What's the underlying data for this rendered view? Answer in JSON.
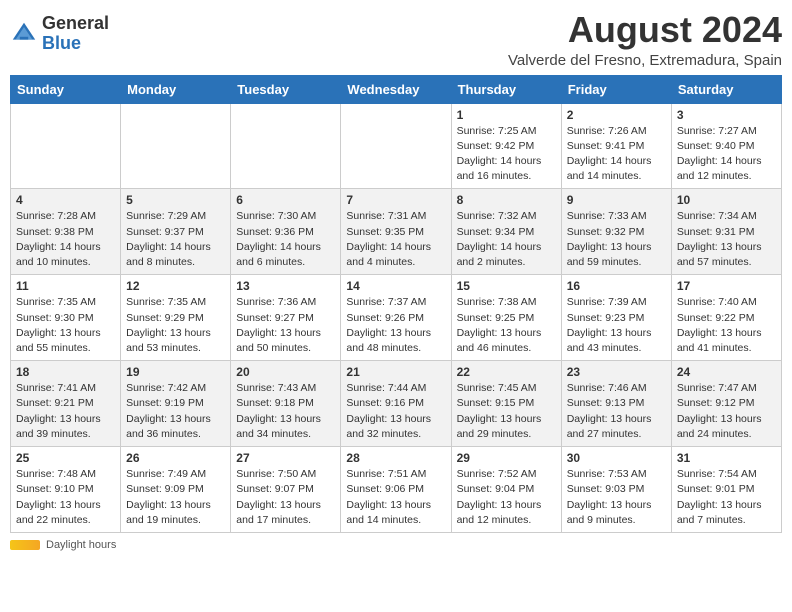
{
  "header": {
    "logo_general": "General",
    "logo_blue": "Blue",
    "month_year": "August 2024",
    "location": "Valverde del Fresno, Extremadura, Spain"
  },
  "days_of_week": [
    "Sunday",
    "Monday",
    "Tuesday",
    "Wednesday",
    "Thursday",
    "Friday",
    "Saturday"
  ],
  "weeks": [
    [
      {
        "day": "",
        "info": ""
      },
      {
        "day": "",
        "info": ""
      },
      {
        "day": "",
        "info": ""
      },
      {
        "day": "",
        "info": ""
      },
      {
        "day": "1",
        "info": "Sunrise: 7:25 AM\nSunset: 9:42 PM\nDaylight: 14 hours\nand 16 minutes."
      },
      {
        "day": "2",
        "info": "Sunrise: 7:26 AM\nSunset: 9:41 PM\nDaylight: 14 hours\nand 14 minutes."
      },
      {
        "day": "3",
        "info": "Sunrise: 7:27 AM\nSunset: 9:40 PM\nDaylight: 14 hours\nand 12 minutes."
      }
    ],
    [
      {
        "day": "4",
        "info": "Sunrise: 7:28 AM\nSunset: 9:38 PM\nDaylight: 14 hours\nand 10 minutes."
      },
      {
        "day": "5",
        "info": "Sunrise: 7:29 AM\nSunset: 9:37 PM\nDaylight: 14 hours\nand 8 minutes."
      },
      {
        "day": "6",
        "info": "Sunrise: 7:30 AM\nSunset: 9:36 PM\nDaylight: 14 hours\nand 6 minutes."
      },
      {
        "day": "7",
        "info": "Sunrise: 7:31 AM\nSunset: 9:35 PM\nDaylight: 14 hours\nand 4 minutes."
      },
      {
        "day": "8",
        "info": "Sunrise: 7:32 AM\nSunset: 9:34 PM\nDaylight: 14 hours\nand 2 minutes."
      },
      {
        "day": "9",
        "info": "Sunrise: 7:33 AM\nSunset: 9:32 PM\nDaylight: 13 hours\nand 59 minutes."
      },
      {
        "day": "10",
        "info": "Sunrise: 7:34 AM\nSunset: 9:31 PM\nDaylight: 13 hours\nand 57 minutes."
      }
    ],
    [
      {
        "day": "11",
        "info": "Sunrise: 7:35 AM\nSunset: 9:30 PM\nDaylight: 13 hours\nand 55 minutes."
      },
      {
        "day": "12",
        "info": "Sunrise: 7:35 AM\nSunset: 9:29 PM\nDaylight: 13 hours\nand 53 minutes."
      },
      {
        "day": "13",
        "info": "Sunrise: 7:36 AM\nSunset: 9:27 PM\nDaylight: 13 hours\nand 50 minutes."
      },
      {
        "day": "14",
        "info": "Sunrise: 7:37 AM\nSunset: 9:26 PM\nDaylight: 13 hours\nand 48 minutes."
      },
      {
        "day": "15",
        "info": "Sunrise: 7:38 AM\nSunset: 9:25 PM\nDaylight: 13 hours\nand 46 minutes."
      },
      {
        "day": "16",
        "info": "Sunrise: 7:39 AM\nSunset: 9:23 PM\nDaylight: 13 hours\nand 43 minutes."
      },
      {
        "day": "17",
        "info": "Sunrise: 7:40 AM\nSunset: 9:22 PM\nDaylight: 13 hours\nand 41 minutes."
      }
    ],
    [
      {
        "day": "18",
        "info": "Sunrise: 7:41 AM\nSunset: 9:21 PM\nDaylight: 13 hours\nand 39 minutes."
      },
      {
        "day": "19",
        "info": "Sunrise: 7:42 AM\nSunset: 9:19 PM\nDaylight: 13 hours\nand 36 minutes."
      },
      {
        "day": "20",
        "info": "Sunrise: 7:43 AM\nSunset: 9:18 PM\nDaylight: 13 hours\nand 34 minutes."
      },
      {
        "day": "21",
        "info": "Sunrise: 7:44 AM\nSunset: 9:16 PM\nDaylight: 13 hours\nand 32 minutes."
      },
      {
        "day": "22",
        "info": "Sunrise: 7:45 AM\nSunset: 9:15 PM\nDaylight: 13 hours\nand 29 minutes."
      },
      {
        "day": "23",
        "info": "Sunrise: 7:46 AM\nSunset: 9:13 PM\nDaylight: 13 hours\nand 27 minutes."
      },
      {
        "day": "24",
        "info": "Sunrise: 7:47 AM\nSunset: 9:12 PM\nDaylight: 13 hours\nand 24 minutes."
      }
    ],
    [
      {
        "day": "25",
        "info": "Sunrise: 7:48 AM\nSunset: 9:10 PM\nDaylight: 13 hours\nand 22 minutes."
      },
      {
        "day": "26",
        "info": "Sunrise: 7:49 AM\nSunset: 9:09 PM\nDaylight: 13 hours\nand 19 minutes."
      },
      {
        "day": "27",
        "info": "Sunrise: 7:50 AM\nSunset: 9:07 PM\nDaylight: 13 hours\nand 17 minutes."
      },
      {
        "day": "28",
        "info": "Sunrise: 7:51 AM\nSunset: 9:06 PM\nDaylight: 13 hours\nand 14 minutes."
      },
      {
        "day": "29",
        "info": "Sunrise: 7:52 AM\nSunset: 9:04 PM\nDaylight: 13 hours\nand 12 minutes."
      },
      {
        "day": "30",
        "info": "Sunrise: 7:53 AM\nSunset: 9:03 PM\nDaylight: 13 hours\nand 9 minutes."
      },
      {
        "day": "31",
        "info": "Sunrise: 7:54 AM\nSunset: 9:01 PM\nDaylight: 13 hours\nand 7 minutes."
      }
    ]
  ],
  "footer": {
    "daylight_label": "Daylight hours"
  }
}
